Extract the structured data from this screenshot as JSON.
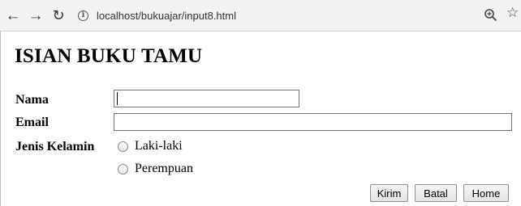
{
  "browser": {
    "back_icon": "arrow-left",
    "forward_icon": "arrow-right",
    "reload_icon": "reload",
    "info_icon": "info-circle",
    "url": "localhost/bukuajar/input8.html",
    "zoom_icon": "magnifier-plus",
    "bookmark_icon": "star-outline"
  },
  "page": {
    "title": "ISIAN BUKU TAMU",
    "form": {
      "nama_label": "Nama",
      "nama_value": "",
      "email_label": "Email",
      "email_value": "",
      "gender_label": "Jenis Kelamin",
      "gender_options": [
        "Laki-laki",
        "Perempuan"
      ],
      "buttons": {
        "submit": "Kirim",
        "reset": "Batal",
        "home": "Home"
      }
    }
  },
  "colors": {
    "focus_border": "#2a5db0",
    "toolbar_bg": "#f2f2f2"
  }
}
